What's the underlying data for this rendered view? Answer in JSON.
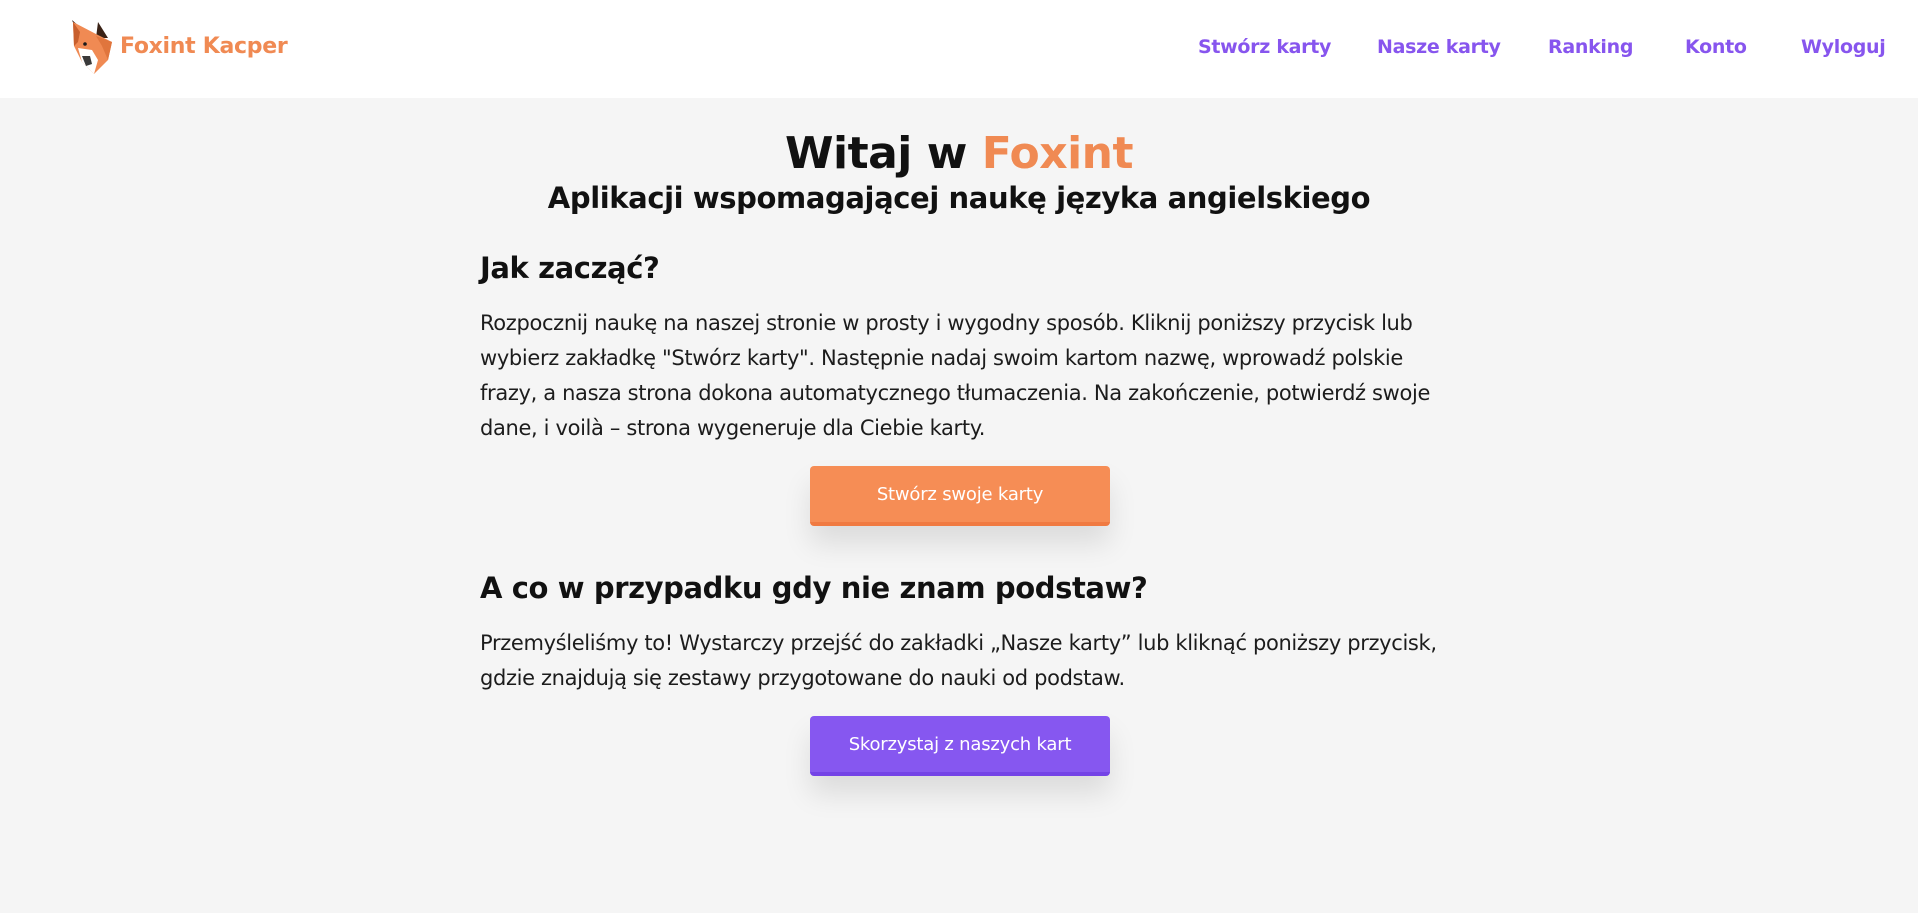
{
  "header": {
    "brand_name": "Foxint Kacper",
    "logo_icon": "fox-head-icon",
    "nav": [
      {
        "label": "Stwórz karty"
      },
      {
        "label": "Nasze karty"
      },
      {
        "label": "Ranking"
      },
      {
        "label": "Konto"
      },
      {
        "label": "Wyloguj"
      }
    ]
  },
  "hero": {
    "title_prefix": "Witaj w ",
    "title_accent": "Foxint",
    "subtitle": "Aplikacji wspomagającej naukę języka angielskiego"
  },
  "sections": [
    {
      "heading": "Jak zacząć?",
      "text": "Rozpocznij naukę na naszej stronie w prosty i wygodny sposób. Kliknij poniższy przycisk lub wybierz zakładkę \"Stwórz karty\". Następnie nadaj swoim kartom nazwę, wprowadź polskie frazy, a nasza strona dokona automatycznego tłumaczenia. Na zakończenie, potwierdź swoje dane, i voilà – strona wygeneruje dla Ciebie karty.",
      "button": "Stwórz swoje karty"
    },
    {
      "heading": "A co w przypadku gdy nie znam podstaw?",
      "text": "Przemyśleliśmy to! Wystarczy przejść do zakładki „Nasze karty” lub kliknąć poniższy przycisk, gdzie znajdują się zestawy przygotowane do nauki od podstaw.",
      "button": "Skorzystaj z naszych kart"
    }
  ],
  "colors": {
    "accent_orange": "#f08a53",
    "accent_purple": "#8755ee",
    "background": "#f5f5f5"
  }
}
